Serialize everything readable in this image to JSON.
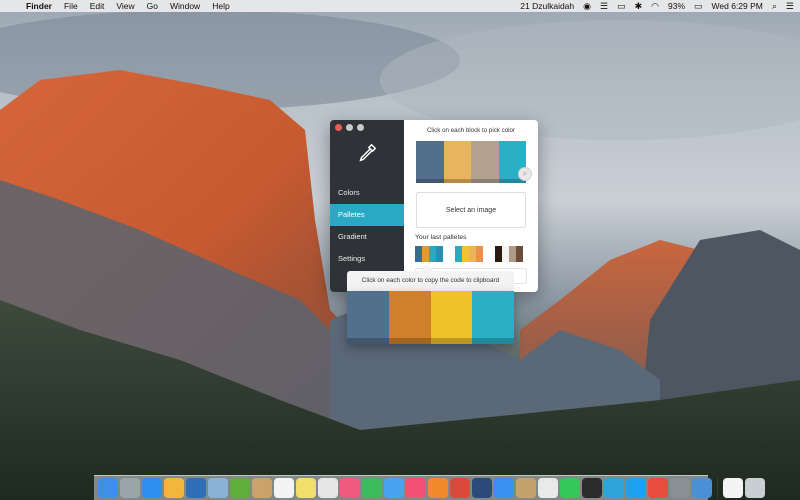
{
  "menubar": {
    "app_name": "Finder",
    "menus": [
      "File",
      "Edit",
      "View",
      "Go",
      "Window",
      "Help"
    ],
    "user": "21 Dzulkaidah",
    "battery": "93%",
    "clock": "Wed 6:29 PM"
  },
  "app": {
    "nav": [
      "Colors",
      "Palletes",
      "Gradient",
      "Settings"
    ],
    "active_nav": "Palletes",
    "hint_top": "Click on each block to pick color",
    "main_palette": [
      "#52708d",
      "#e8b45c",
      "#b3a290",
      "#2ab0c6"
    ],
    "select_image_label": "Select an image",
    "last_palettes_label": "Your last palletes",
    "last_palettes": [
      [
        "#3b6b8e",
        "#e29a30",
        "#2aa9c4",
        "#2a8fb5"
      ],
      [
        "#2aa9c4",
        "#f1c232",
        "#e8b45c",
        "#f08f4a"
      ],
      [
        "#2b1a10",
        "#f3f3f3",
        "#b09a87",
        "#6b4e3a"
      ]
    ]
  },
  "popover": {
    "tip": "Click on each color to copy the code to clipboard",
    "colors": [
      "#52708d",
      "#d0802b",
      "#f0c22a",
      "#2ab0c6"
    ]
  },
  "dock": {
    "icons": [
      {
        "name": "finder-icon",
        "color": "#3f8ee8"
      },
      {
        "name": "launchpad-icon",
        "color": "#9aa4ad"
      },
      {
        "name": "safari-icon",
        "color": "#2f8ff0"
      },
      {
        "name": "sketch-icon",
        "color": "#f4b63a"
      },
      {
        "name": "photoshop-icon",
        "color": "#2d6eb6"
      },
      {
        "name": "preview-icon",
        "color": "#8bb3d5"
      },
      {
        "name": "leaf-icon",
        "color": "#5fae3a"
      },
      {
        "name": "notes-icon",
        "color": "#c9a36a"
      },
      {
        "name": "calendar-icon",
        "color": "#f4f4f4"
      },
      {
        "name": "stickies-icon",
        "color": "#f2df6a"
      },
      {
        "name": "photos-edit-icon",
        "color": "#e7e7e7"
      },
      {
        "name": "photos-icon",
        "color": "#f05a7e"
      },
      {
        "name": "facetime-icon",
        "color": "#3cbc5a"
      },
      {
        "name": "messages-icon",
        "color": "#4aa3f2"
      },
      {
        "name": "music-icon",
        "color": "#f35078"
      },
      {
        "name": "ibooks-icon",
        "color": "#f08a2a"
      },
      {
        "name": "sequel-icon",
        "color": "#d94a3a"
      },
      {
        "name": "quicktime-icon",
        "color": "#2b4a7a"
      },
      {
        "name": "appstore-icon",
        "color": "#3a8ff0"
      },
      {
        "name": "archive-icon",
        "color": "#c4a36a"
      },
      {
        "name": "chrome-icon",
        "color": "#e9e9e9"
      },
      {
        "name": "whatsapp-icon",
        "color": "#34c759"
      },
      {
        "name": "terminal-icon",
        "color": "#2b2b2b"
      },
      {
        "name": "telegram-icon",
        "color": "#2fa3dc"
      },
      {
        "name": "twitter-icon",
        "color": "#1da1f2"
      },
      {
        "name": "skype-icon",
        "color": "#e74c3c"
      },
      {
        "name": "settings-icon",
        "color": "#8a8f96"
      },
      {
        "name": "mail-icon",
        "color": "#4a90d9"
      },
      {
        "name": "document-icon",
        "color": "#f4f4f4"
      },
      {
        "name": "trash-icon",
        "color": "#c9ced3"
      }
    ]
  }
}
